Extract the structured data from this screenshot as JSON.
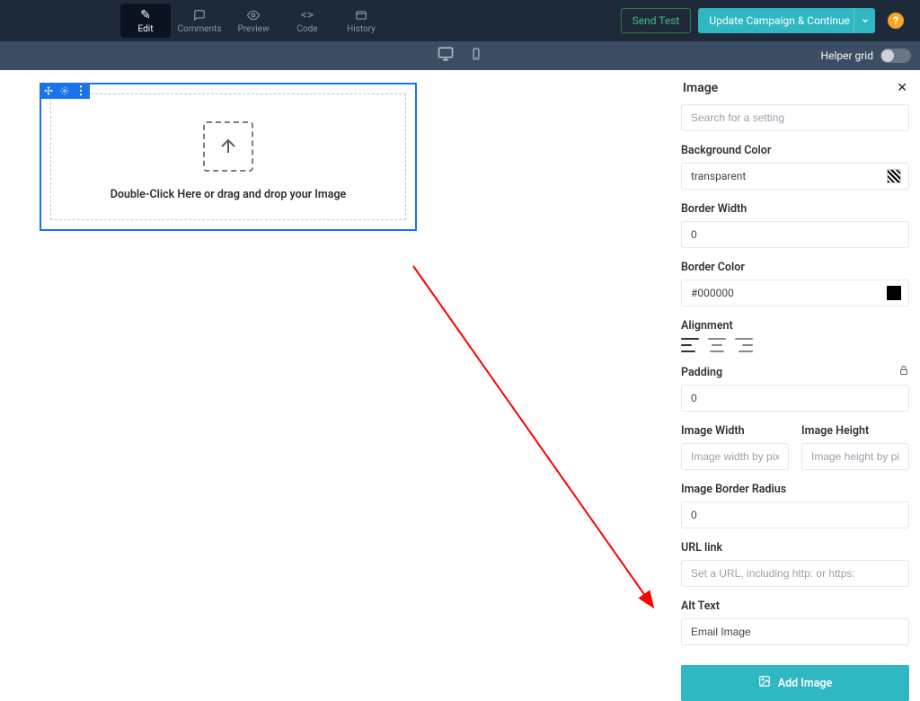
{
  "toolbar": {
    "tabs": {
      "edit": "Edit",
      "comments": "Comments",
      "preview": "Preview",
      "code": "Code",
      "history": "History"
    },
    "send_test": "Send Test",
    "update_campaign": "Update Campaign & Continue",
    "help": "?"
  },
  "device_bar": {
    "helper_grid_label": "Helper grid"
  },
  "canvas": {
    "drop_text": "Double-Click Here or drag and drop your Image"
  },
  "panel": {
    "title": "Image",
    "search_placeholder": "Search for a setting",
    "bg_color_label": "Background Color",
    "bg_color_value": "transparent",
    "border_width_label": "Border Width",
    "border_width_value": "0",
    "border_color_label": "Border Color",
    "border_color_value": "#000000",
    "alignment_label": "Alignment",
    "padding_label": "Padding",
    "padding_value": "0",
    "image_width_label": "Image Width",
    "image_width_placeholder": "Image width by pixel",
    "image_height_label": "Image Height",
    "image_height_placeholder": "Image height by pixel",
    "image_border_radius_label": "Image Border Radius",
    "image_border_radius_value": "0",
    "url_link_label": "URL link",
    "url_link_placeholder": "Set a URL, including http: or https:",
    "alt_text_label": "Alt Text",
    "alt_text_value": "Email Image",
    "add_image_label": "Add Image"
  }
}
